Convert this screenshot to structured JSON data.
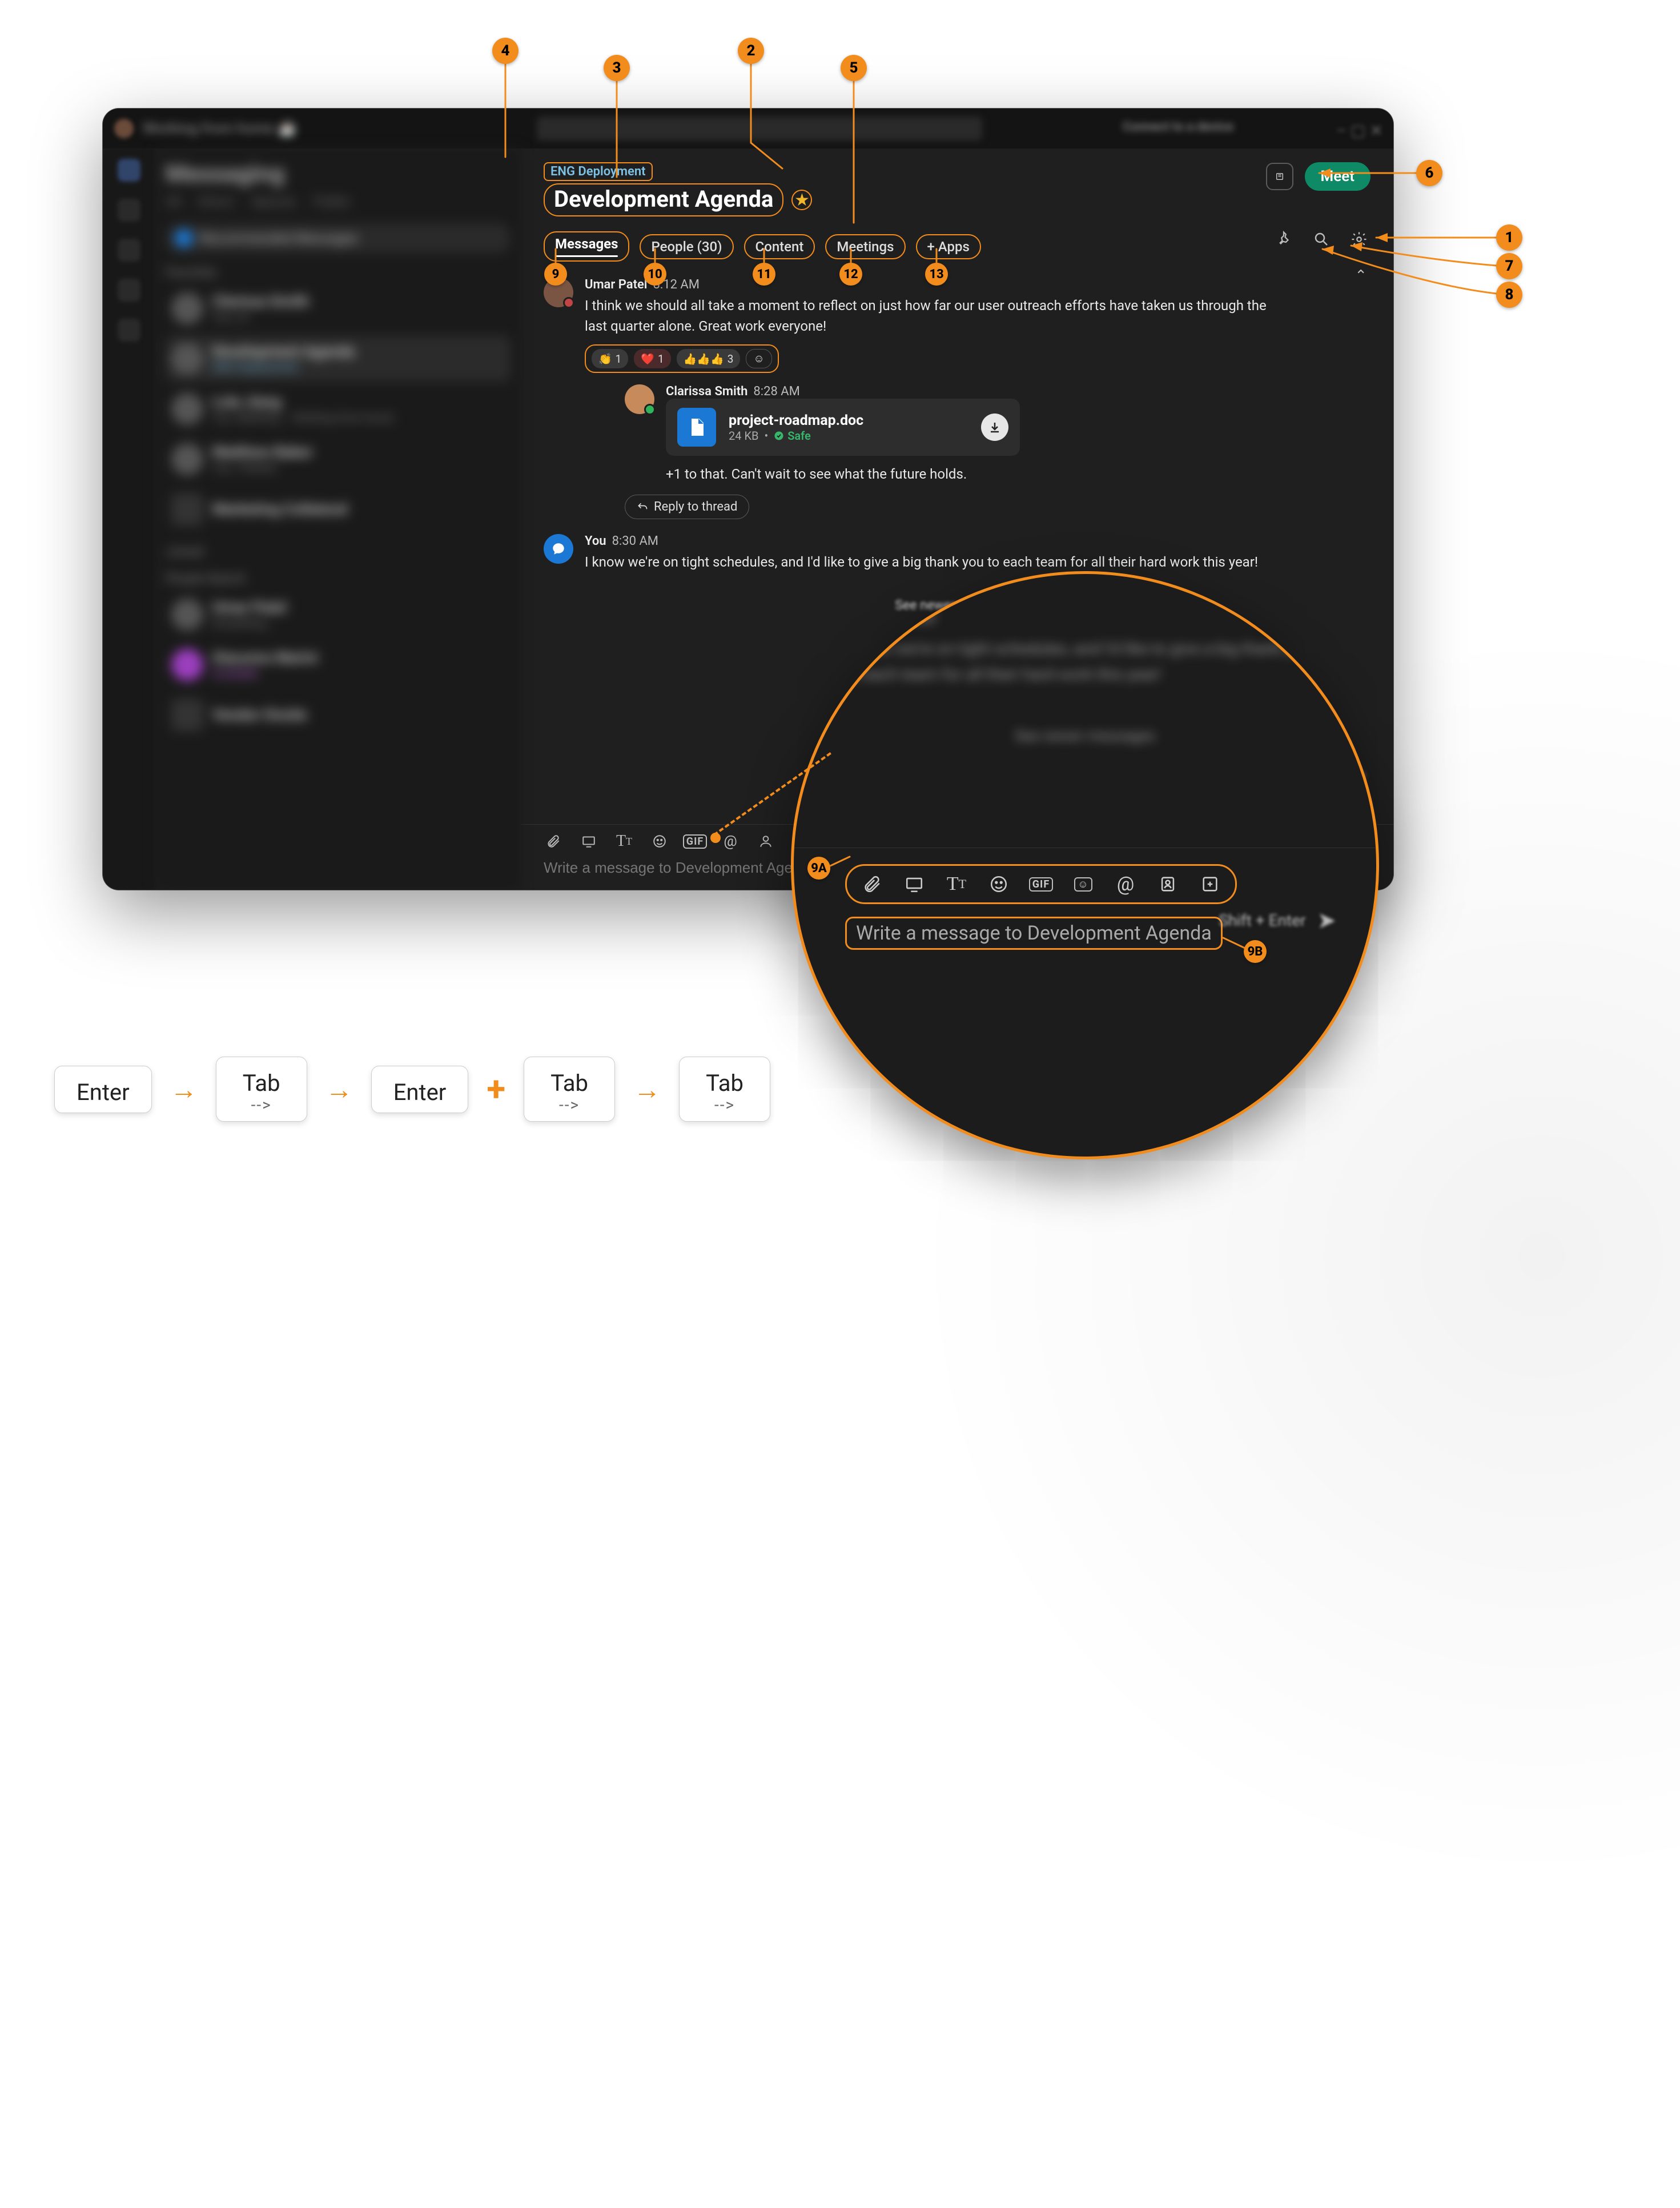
{
  "colors": {
    "accent_orange": "#f28c1d",
    "meet_green": "#0f8a67",
    "link_blue": "#7ec2e6",
    "file_blue": "#1b78d4",
    "safe_green": "#37b76c"
  },
  "window": {
    "title_blurred": "Working from home ☕",
    "search_placeholder_blurred": "Search, meet, and call",
    "contact_blurred": "Connect to a device"
  },
  "sidebar": {
    "heading": "Messaging",
    "filters": [
      "All",
      "Direct",
      "Spaces",
      "Public"
    ],
    "section_favorites": "Favorites",
    "section_joined": "Joined",
    "section_people": "People Search",
    "items": [
      {
        "line1": "Clarissa Smith",
        "line2": "You: Hi"
      },
      {
        "line1": "Development Agenda",
        "line2": "ENG Deployment",
        "selected": true
      },
      {
        "line1": "Lola Jiang",
        "line2": "You: Meeting — Working from home"
      },
      {
        "line1": "Matthew Baker",
        "line2": "You: Thanks!"
      },
      {
        "line1": "Marketing Collateral",
        "line2": ""
      }
    ]
  },
  "space": {
    "breadcrumb": "ENG Deployment",
    "title": "Development Agenda",
    "favorite": true,
    "meet_label": "Meet"
  },
  "tabs": {
    "items": [
      {
        "label": "Messages",
        "active": true
      },
      {
        "label": "People (30)",
        "active": false
      },
      {
        "label": "Content",
        "active": false
      },
      {
        "label": "Meetings",
        "active": false
      },
      {
        "label": "+ Apps",
        "active": false
      }
    ]
  },
  "header_icons": {
    "pin": "pin-icon",
    "search": "search-icon",
    "settings": "gear-icon",
    "viewer": "viewer-icon"
  },
  "messages": [
    {
      "author": "Umar Patel",
      "time": "8:12 AM",
      "presence": "dnd",
      "text": "I think we should all take a moment to reflect on just how far our user outreach efforts have taken us through the last quarter alone. Great work everyone!",
      "reactions": [
        {
          "emoji": "👏",
          "count": "1"
        },
        {
          "emoji": "❤️",
          "count": "1"
        },
        {
          "emoji": "👍👍👍",
          "count": "3"
        }
      ],
      "add_reaction_icon": "add-reaction",
      "thread": {
        "author": "Clarissa Smith",
        "time": "8:28 AM",
        "presence": "active",
        "attachment": {
          "name": "project-roadmap.doc",
          "size": "24 KB",
          "safe_label": "Safe"
        },
        "text": "+1 to that. Can't wait to see what the future holds."
      },
      "reply_label": "Reply to thread"
    },
    {
      "author": "You",
      "time": "8:30 AM",
      "self": true,
      "text": "I know we're on tight schedules, and I'd like to give a big thank you to each team for all their hard work this year!"
    }
  ],
  "see_newer_label": "See newer messages",
  "compose": {
    "icons": [
      "attach",
      "screen-capture",
      "format",
      "emoji",
      "gif",
      "mention",
      "bitmoji",
      "apps"
    ],
    "placeholder": "Write a message to Development Agenda",
    "hint": "Shift + Enter"
  },
  "lens": {
    "icons": [
      "attach",
      "screen-capture",
      "format",
      "emoji",
      "gif",
      "sticker",
      "mention",
      "person",
      "add-app"
    ],
    "placeholder": "Write a message to Development Agenda",
    "hint": "Shift + Enter",
    "line_fragment_1": "You  8:30 AM",
    "line_fragment_2": "I know we're on tight schedules, and I'd like to give a big thank you to each team for all their hard work this year!"
  },
  "annotations": {
    "1": "1",
    "2": "2",
    "3": "3",
    "4": "4",
    "5": "5",
    "6": "6",
    "7": "7",
    "8": "8",
    "9": "9",
    "10": "10",
    "11": "11",
    "12": "12",
    "13": "13",
    "9A": "9A",
    "9B": "9B"
  },
  "keyrow": {
    "keys": [
      {
        "label": "Enter",
        "sub": ""
      },
      {
        "label": "Tab",
        "sub": "-->"
      },
      {
        "label": "Enter",
        "sub": ""
      },
      {
        "label": "Tab",
        "sub": "-->"
      },
      {
        "label": "Tab",
        "sub": "-->"
      }
    ],
    "connectors": [
      "arrow",
      "arrow",
      "plus",
      "arrow"
    ]
  }
}
